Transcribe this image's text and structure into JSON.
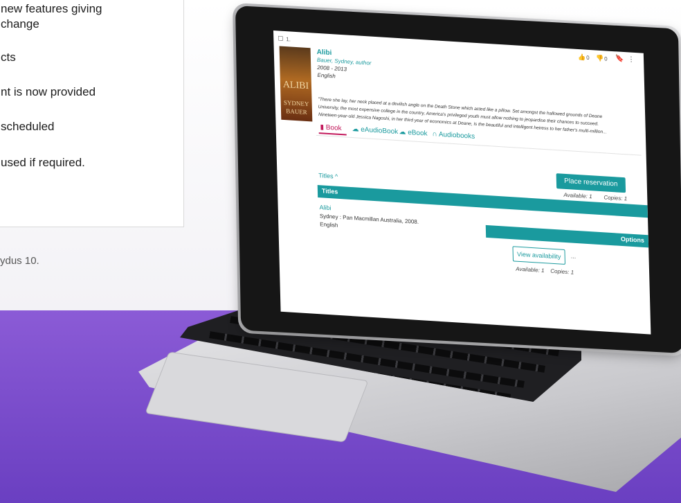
{
  "left_panel": {
    "lines": [
      "new features giving",
      "change",
      "cts",
      "nt is now provided",
      "scheduled",
      "used if required."
    ],
    "caption": "ydus 10."
  },
  "screen": {
    "result_index": "1.",
    "likes": "0",
    "dislikes": "0",
    "bookmark_icon": "bookmark-icon",
    "more_icon": "more-vert-icon",
    "book": {
      "title": "Alibi",
      "author": "Bauer, Sydney, author",
      "years": "2008 - 2013",
      "language": "English",
      "cover_title": "ALIBI",
      "cover_author_first": "SYDNEY",
      "cover_author_last": "BAUER",
      "summary_line1": "\"There she lay, her neck placed at a devilish angle on the Death Stone which acted like a pillow. Set amongst the hallowed grounds of Deane",
      "summary_line2": "University, the most expensive college in the country, America's privileged youth must allow nothing to jeopardise their chances to succeed.",
      "summary_line3": "Nineteen-year-old Jessica Nagoshi, in her third year of economics at Deane, is the beautiful and intelligent heiress to her father's multi-million..."
    },
    "formats": [
      {
        "label": "Book",
        "icon": "book-icon"
      },
      {
        "label": "eAudioBook",
        "icon": "cloud-icon"
      },
      {
        "label": "eBook",
        "icon": "cloud-icon"
      },
      {
        "label": "Audiobooks",
        "icon": "headphones-icon"
      }
    ],
    "place_reservation": "Place reservation",
    "availability_top": "Available: 1",
    "copies_top": "Copies: 1",
    "titles_toggle": "Titles",
    "titles_header": "Titles",
    "item": {
      "title": "Alibi",
      "publisher": "Sydney : Pan Macmillan Australia, 2008.",
      "language": "English"
    },
    "options_label": "Options",
    "view_availability": "View availability",
    "ellipsis": "...",
    "availability_bottom": "Available: 1",
    "copies_bottom": "Copies: 1"
  },
  "colors": {
    "accent": "#1a9a9e",
    "book_tab": "#c2185b",
    "background_band": "#7b4fd0"
  }
}
